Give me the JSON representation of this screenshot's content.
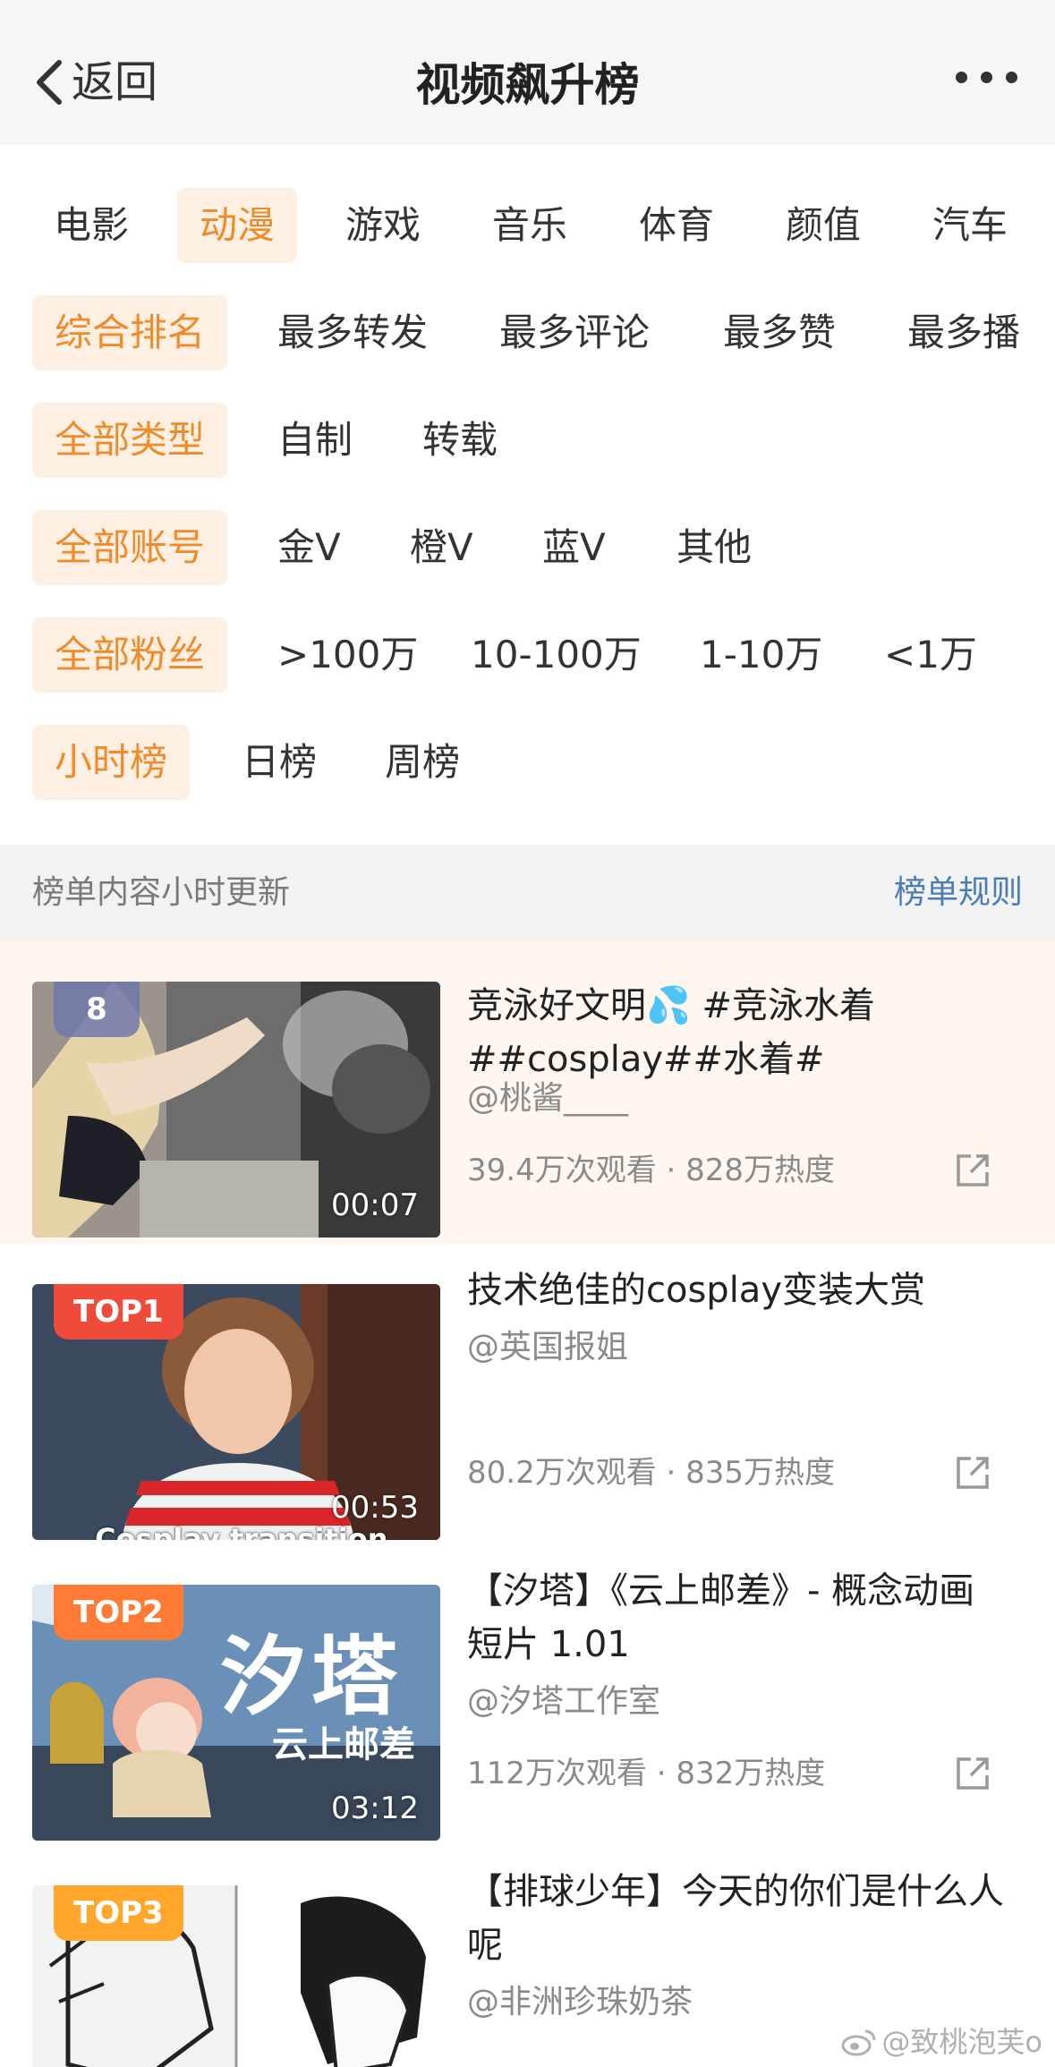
{
  "nav": {
    "back_label": "返回",
    "title": "视频飙升榜"
  },
  "filters": {
    "categories": [
      "电影",
      "动漫",
      "游戏",
      "音乐",
      "体育",
      "颜值",
      "汽车"
    ],
    "sort": [
      "综合排名",
      "最多转发",
      "最多评论",
      "最多赞",
      "最多播"
    ],
    "type": [
      "全部类型",
      "自制",
      "转载"
    ],
    "account": [
      "全部账号",
      "金V",
      "橙V",
      "蓝V",
      "其他"
    ],
    "fans": [
      "全部粉丝",
      ">100万",
      "10-100万",
      "1-10万",
      "<1万"
    ],
    "period": [
      "小时榜",
      "日榜",
      "周榜"
    ]
  },
  "info": {
    "note": "榜单内容小时更新",
    "rules": "榜单规则"
  },
  "colors": {
    "accent": "#f08b2c",
    "accent_bg": "#fdf0e3",
    "link": "#4a7db3",
    "top1": "#f04a3a",
    "top2": "#ff7a35",
    "top3": "#ffa62b"
  },
  "items": [
    {
      "rank": "8",
      "duration": "00:07",
      "title_prefix": "竞泳好文明",
      "title_emoji": "💦",
      "title_suffix": " #竞泳水着##cosplay##水着#",
      "author": "@桃酱____",
      "views": "39.4万次观看",
      "sep": "·",
      "heat": "828万热度"
    },
    {
      "rank": "TOP1",
      "duration": "00:53",
      "title": "技术绝佳的cosplay变装大赏",
      "author": "@英国报姐",
      "views": "80.2万次观看",
      "sep": "·",
      "heat": "835万热度",
      "thumb_caption": "Cosplay transition"
    },
    {
      "rank": "TOP2",
      "duration": "03:12",
      "title": "【汐塔】《云上邮差》- 概念动画短片 1.01",
      "author": "@汐塔工作室",
      "views": "112万次观看",
      "sep": "·",
      "heat": "832万热度",
      "thumb_title": "汐塔",
      "thumb_subtitle": "云上邮差"
    },
    {
      "rank": "TOP3",
      "title": "【排球少年】今天的你们是什么人呢",
      "author": "@非洲珍珠奶茶"
    }
  ],
  "watermark": "@致桃泡芙o"
}
